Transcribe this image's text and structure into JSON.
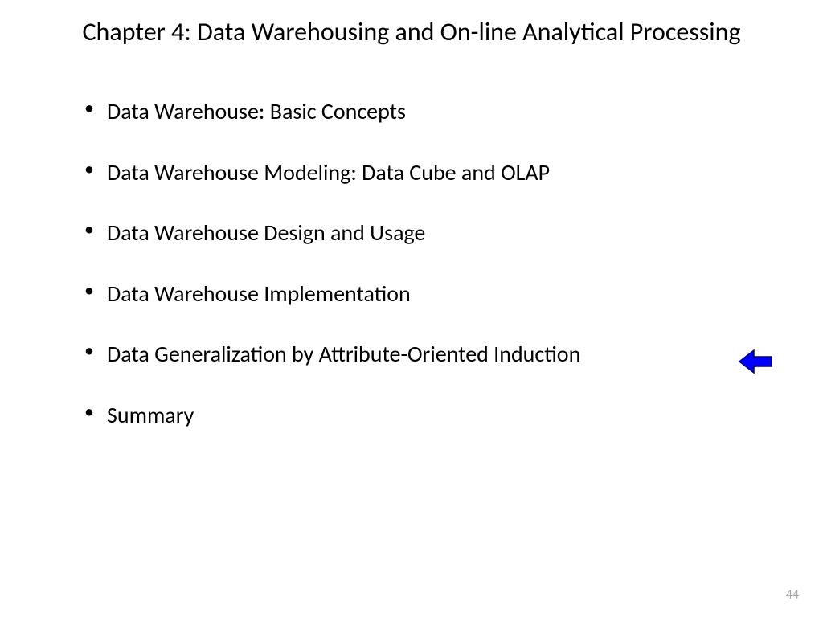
{
  "slide": {
    "title": "Chapter 4: Data Warehousing and On-line Analytical Processing",
    "bullets": {
      "item0": "Data Warehouse: Basic Concepts",
      "item1": "Data Warehouse Modeling: Data Cube and OLAP",
      "item2": "Data Warehouse Design and Usage",
      "item3": "Data Warehouse Implementation",
      "item4": "Data Generalization by Attribute-Oriented Induction",
      "item5": "Summary"
    },
    "page_number": "44"
  }
}
